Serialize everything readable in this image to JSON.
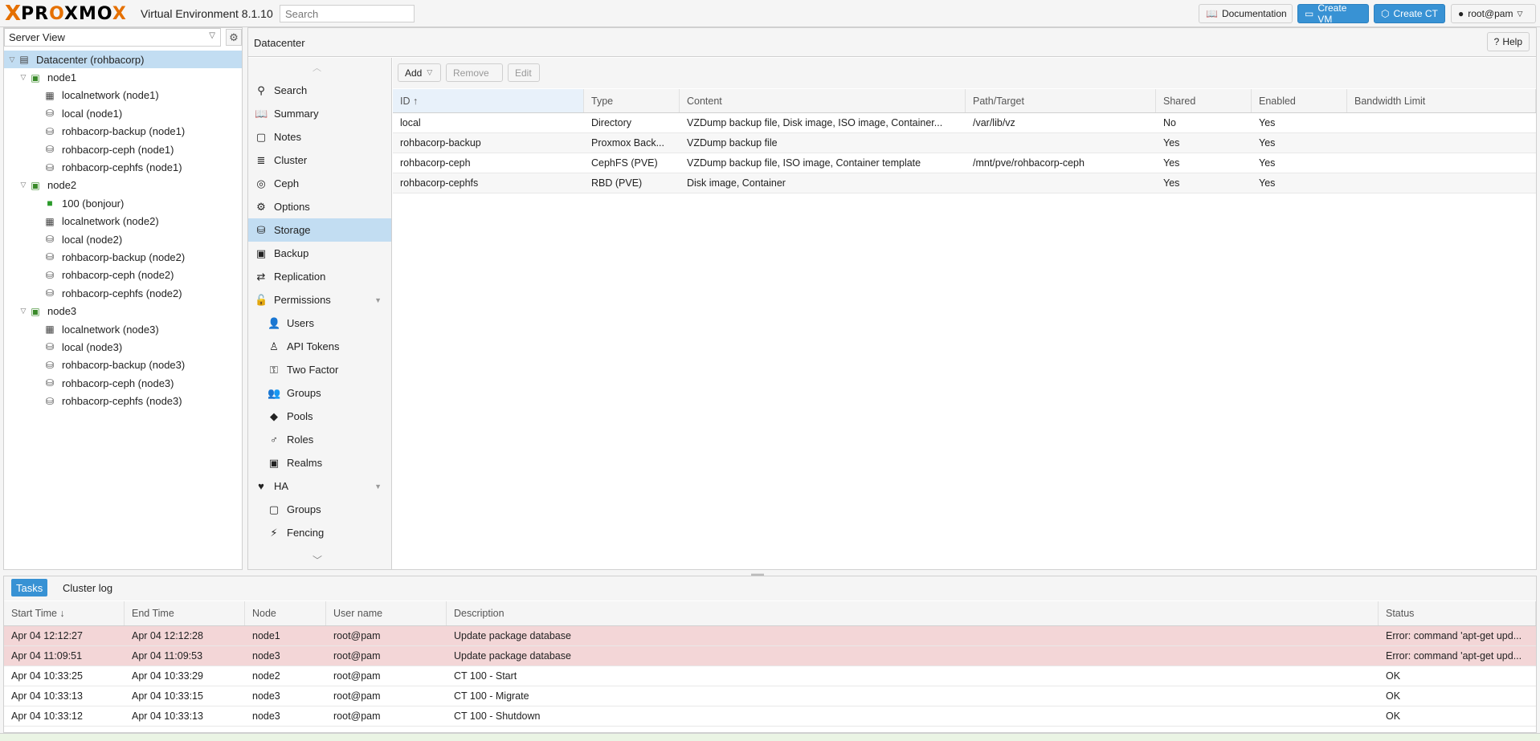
{
  "header": {
    "logo_x": "X",
    "logo_word_pre": "PR",
    "logo_word_o": "O",
    "logo_word_post": "XMO",
    "logo_word_end": "X",
    "version": "Virtual Environment 8.1.10",
    "search_placeholder": "Search",
    "documentation_label": "Documentation",
    "create_vm_label": "Create VM",
    "create_ct_label": "Create CT",
    "user_label": "root@pam"
  },
  "tree": {
    "view_label": "Server View",
    "items": [
      {
        "label": "Datacenter (rohbacorp)",
        "icon": "datacenter-icon",
        "level": 0,
        "toggle": "▽"
      },
      {
        "label": "node1",
        "icon": "node-online-icon",
        "level": 1,
        "toggle": "▽"
      },
      {
        "label": "localnetwork (node1)",
        "icon": "network-icon",
        "level": 2,
        "toggle": ""
      },
      {
        "label": "local (node1)",
        "icon": "storage-icon",
        "level": 2,
        "toggle": ""
      },
      {
        "label": "rohbacorp-backup (node1)",
        "icon": "backup-storage-icon",
        "level": 2,
        "toggle": ""
      },
      {
        "label": "rohbacorp-ceph (node1)",
        "icon": "storage-icon",
        "level": 2,
        "toggle": ""
      },
      {
        "label": "rohbacorp-cephfs (node1)",
        "icon": "storage-icon",
        "level": 2,
        "toggle": ""
      },
      {
        "label": "node2",
        "icon": "node-online-icon",
        "level": 1,
        "toggle": "▽"
      },
      {
        "label": "100 (bonjour)",
        "icon": "container-running-icon",
        "level": 2,
        "toggle": ""
      },
      {
        "label": "localnetwork (node2)",
        "icon": "network-icon",
        "level": 2,
        "toggle": ""
      },
      {
        "label": "local (node2)",
        "icon": "storage-icon",
        "level": 2,
        "toggle": ""
      },
      {
        "label": "rohbacorp-backup (node2)",
        "icon": "backup-storage-icon",
        "level": 2,
        "toggle": ""
      },
      {
        "label": "rohbacorp-ceph (node2)",
        "icon": "storage-icon",
        "level": 2,
        "toggle": ""
      },
      {
        "label": "rohbacorp-cephfs (node2)",
        "icon": "storage-icon",
        "level": 2,
        "toggle": ""
      },
      {
        "label": "node3",
        "icon": "node-online-icon",
        "level": 1,
        "toggle": "▽"
      },
      {
        "label": "localnetwork (node3)",
        "icon": "network-icon",
        "level": 2,
        "toggle": ""
      },
      {
        "label": "local (node3)",
        "icon": "storage-icon",
        "level": 2,
        "toggle": ""
      },
      {
        "label": "rohbacorp-backup (node3)",
        "icon": "backup-storage-icon",
        "level": 2,
        "toggle": ""
      },
      {
        "label": "rohbacorp-ceph (node3)",
        "icon": "storage-icon",
        "level": 2,
        "toggle": ""
      },
      {
        "label": "rohbacorp-cephfs (node3)",
        "icon": "storage-icon",
        "level": 2,
        "toggle": ""
      }
    ]
  },
  "content": {
    "title": "Datacenter",
    "help_label": "Help"
  },
  "menu": {
    "items": [
      {
        "label": "Search",
        "icon": "search-icon",
        "sub": false,
        "selected": false
      },
      {
        "label": "Summary",
        "icon": "book-icon",
        "sub": false,
        "selected": false
      },
      {
        "label": "Notes",
        "icon": "notes-icon",
        "sub": false,
        "selected": false
      },
      {
        "label": "Cluster",
        "icon": "cluster-icon",
        "sub": false,
        "selected": false
      },
      {
        "label": "Ceph",
        "icon": "ceph-icon",
        "sub": false,
        "selected": false
      },
      {
        "label": "Options",
        "icon": "gear-icon",
        "sub": false,
        "selected": false
      },
      {
        "label": "Storage",
        "icon": "database-icon",
        "sub": false,
        "selected": true
      },
      {
        "label": "Backup",
        "icon": "floppy-icon",
        "sub": false,
        "selected": false
      },
      {
        "label": "Replication",
        "icon": "replication-icon",
        "sub": false,
        "selected": false
      },
      {
        "label": "Permissions",
        "icon": "unlock-icon",
        "sub": false,
        "selected": false,
        "expand": true
      },
      {
        "label": "Users",
        "icon": "user-icon",
        "sub": true,
        "selected": false
      },
      {
        "label": "API Tokens",
        "icon": "user-outline-icon",
        "sub": true,
        "selected": false
      },
      {
        "label": "Two Factor",
        "icon": "key-icon",
        "sub": true,
        "selected": false
      },
      {
        "label": "Groups",
        "icon": "users-icon",
        "sub": true,
        "selected": false
      },
      {
        "label": "Pools",
        "icon": "tags-icon",
        "sub": true,
        "selected": false
      },
      {
        "label": "Roles",
        "icon": "male-icon",
        "sub": true,
        "selected": false
      },
      {
        "label": "Realms",
        "icon": "id-badge-icon",
        "sub": true,
        "selected": false
      },
      {
        "label": "HA",
        "icon": "heartbeat-icon",
        "sub": false,
        "selected": false,
        "expand": true
      },
      {
        "label": "Groups",
        "icon": "object-group-icon",
        "sub": true,
        "selected": false
      },
      {
        "label": "Fencing",
        "icon": "bolt-icon",
        "sub": true,
        "selected": false
      }
    ]
  },
  "storage": {
    "toolbar": {
      "add_label": "Add",
      "remove_label": "Remove",
      "edit_label": "Edit"
    },
    "columns": [
      "ID ↑",
      "Type",
      "Content",
      "Path/Target",
      "Shared",
      "Enabled",
      "Bandwidth Limit"
    ],
    "rows": [
      [
        "local",
        "Directory",
        "VZDump backup file, Disk image, ISO image, Container...",
        "/var/lib/vz",
        "No",
        "Yes",
        ""
      ],
      [
        "rohbacorp-backup",
        "Proxmox Back...",
        "VZDump backup file",
        "",
        "Yes",
        "Yes",
        ""
      ],
      [
        "rohbacorp-ceph",
        "CephFS (PVE)",
        "VZDump backup file, ISO image, Container template",
        "/mnt/pve/rohbacorp-ceph",
        "Yes",
        "Yes",
        ""
      ],
      [
        "rohbacorp-cephfs",
        "RBD (PVE)",
        "Disk image, Container",
        "",
        "Yes",
        "Yes",
        ""
      ]
    ]
  },
  "log": {
    "tabs": [
      "Tasks",
      "Cluster log"
    ],
    "columns": [
      "Start Time ↓",
      "End Time",
      "Node",
      "User name",
      "Description",
      "Status"
    ],
    "rows": [
      {
        "cells": [
          "Apr 04 12:12:27",
          "Apr 04 12:12:28",
          "node1",
          "root@pam",
          "Update package database",
          "Error: command 'apt-get upd..."
        ],
        "error": true
      },
      {
        "cells": [
          "Apr 04 11:09:51",
          "Apr 04 11:09:53",
          "node3",
          "root@pam",
          "Update package database",
          "Error: command 'apt-get upd..."
        ],
        "error": true
      },
      {
        "cells": [
          "Apr 04 10:33:25",
          "Apr 04 10:33:29",
          "node2",
          "root@pam",
          "CT 100 - Start",
          "OK"
        ],
        "error": false
      },
      {
        "cells": [
          "Apr 04 10:33:13",
          "Apr 04 10:33:15",
          "node3",
          "root@pam",
          "CT 100 - Migrate",
          "OK"
        ],
        "error": false
      },
      {
        "cells": [
          "Apr 04 10:33:12",
          "Apr 04 10:33:13",
          "node3",
          "root@pam",
          "CT 100 - Shutdown",
          "OK"
        ],
        "error": false
      }
    ]
  },
  "colors": {
    "accent": "#3892d4",
    "brand_orange": "#e57000",
    "selected_bg": "#c2ddf2",
    "error_row_bg": "#f3d6d7"
  }
}
